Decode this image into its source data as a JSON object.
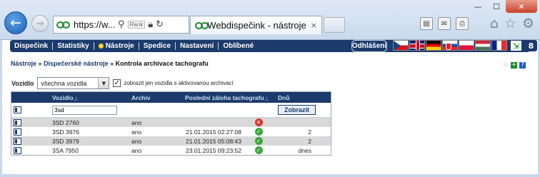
{
  "browser": {
    "url": "https://w...",
    "rank_label": "Rank",
    "tab_title": "Webdispečink - nástroje",
    "tab_close": "×",
    "window_buttons": [
      "—",
      "☐",
      "✕"
    ],
    "toolbar_icons": [
      "page-icon",
      "mail-icon",
      "print-icon"
    ],
    "right_icons": [
      "home-icon",
      "star-icon",
      "gear-icon"
    ]
  },
  "menu": {
    "items": [
      "Dispečink",
      "Statistiky",
      "Nástroje",
      "Spedice",
      "Nastavení",
      "Oblíbené"
    ],
    "active_dot_color": "#ffd327",
    "logout": "Odhlášení"
  },
  "languages": [
    "cz",
    "gb",
    "de",
    "sk",
    "pl",
    "hu",
    "fr"
  ],
  "breadcrumb": {
    "items": [
      "Nástroje",
      "Dispečerské nástroje"
    ],
    "current": "Kontrola archivace tachografu",
    "separator": "»"
  },
  "filter": {
    "label": "Vozidlo",
    "select_value": "všechna vozidla",
    "checkbox_checked": true,
    "checkbox_label": "zobrazit jen vozidla s aktivovanou archivací"
  },
  "table": {
    "headers": {
      "vehicle": "Vozidlo",
      "archive": "Archiv",
      "last_backup": "Poslední záloha tachografu",
      "days": "Dnů"
    },
    "filter_value": "3sd",
    "show_button": "Zobrazit",
    "rows": [
      {
        "vehicle": "3SD 2760",
        "archive": "ano",
        "last_backup": "",
        "status": "error",
        "days": ""
      },
      {
        "vehicle": "3SD 3976",
        "archive": "ano",
        "last_backup": "21.01.2015 02:27:08",
        "status": "ok",
        "days": "2"
      },
      {
        "vehicle": "3SD 3979",
        "archive": "ano",
        "last_backup": "21.01.2015 05:08:43",
        "status": "ok",
        "days": "2"
      },
      {
        "vehicle": "3SA 7950",
        "archive": "ano",
        "last_backup": "23.01.2015 09:23:52",
        "status": "ok",
        "days": "dnes"
      }
    ]
  },
  "colors": {
    "navy": "#1c3a6b",
    "ok": "#3aa73a",
    "error": "#d9342b"
  }
}
